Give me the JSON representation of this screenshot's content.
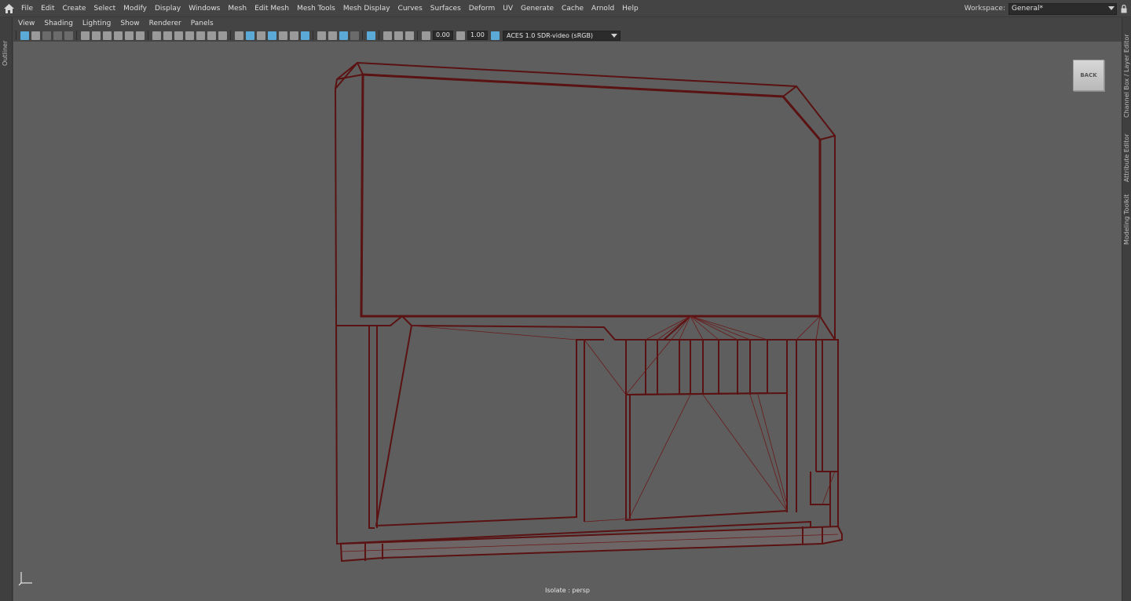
{
  "menubar": {
    "items": [
      "File",
      "Edit",
      "Create",
      "Select",
      "Modify",
      "Display",
      "Windows",
      "Mesh",
      "Edit Mesh",
      "Mesh Tools",
      "Mesh Display",
      "Curves",
      "Surfaces",
      "Deform",
      "UV",
      "Generate",
      "Cache",
      "Arnold",
      "Help"
    ],
    "workspace_label": "Workspace:",
    "workspace_value": "General*"
  },
  "outliner": {
    "label": "Outliner"
  },
  "right_tabs": [
    "Channel Box / Layer Editor",
    "Attribute Editor",
    "Modeling Toolkit"
  ],
  "panel_menu": {
    "items": [
      "View",
      "Shading",
      "Lighting",
      "Show",
      "Renderer",
      "Panels"
    ]
  },
  "panel_toolbar": {
    "exposure": "0.00",
    "gamma": "1.00",
    "color_space": "ACES 1.0 SDR-video (sRGB)",
    "active_color": "#5aa9d6"
  },
  "viewport": {
    "view_cube_label": "BACK",
    "status": "Isolate : persp",
    "wire_color": "#5a1212",
    "background_color": "#5e5e5e"
  }
}
